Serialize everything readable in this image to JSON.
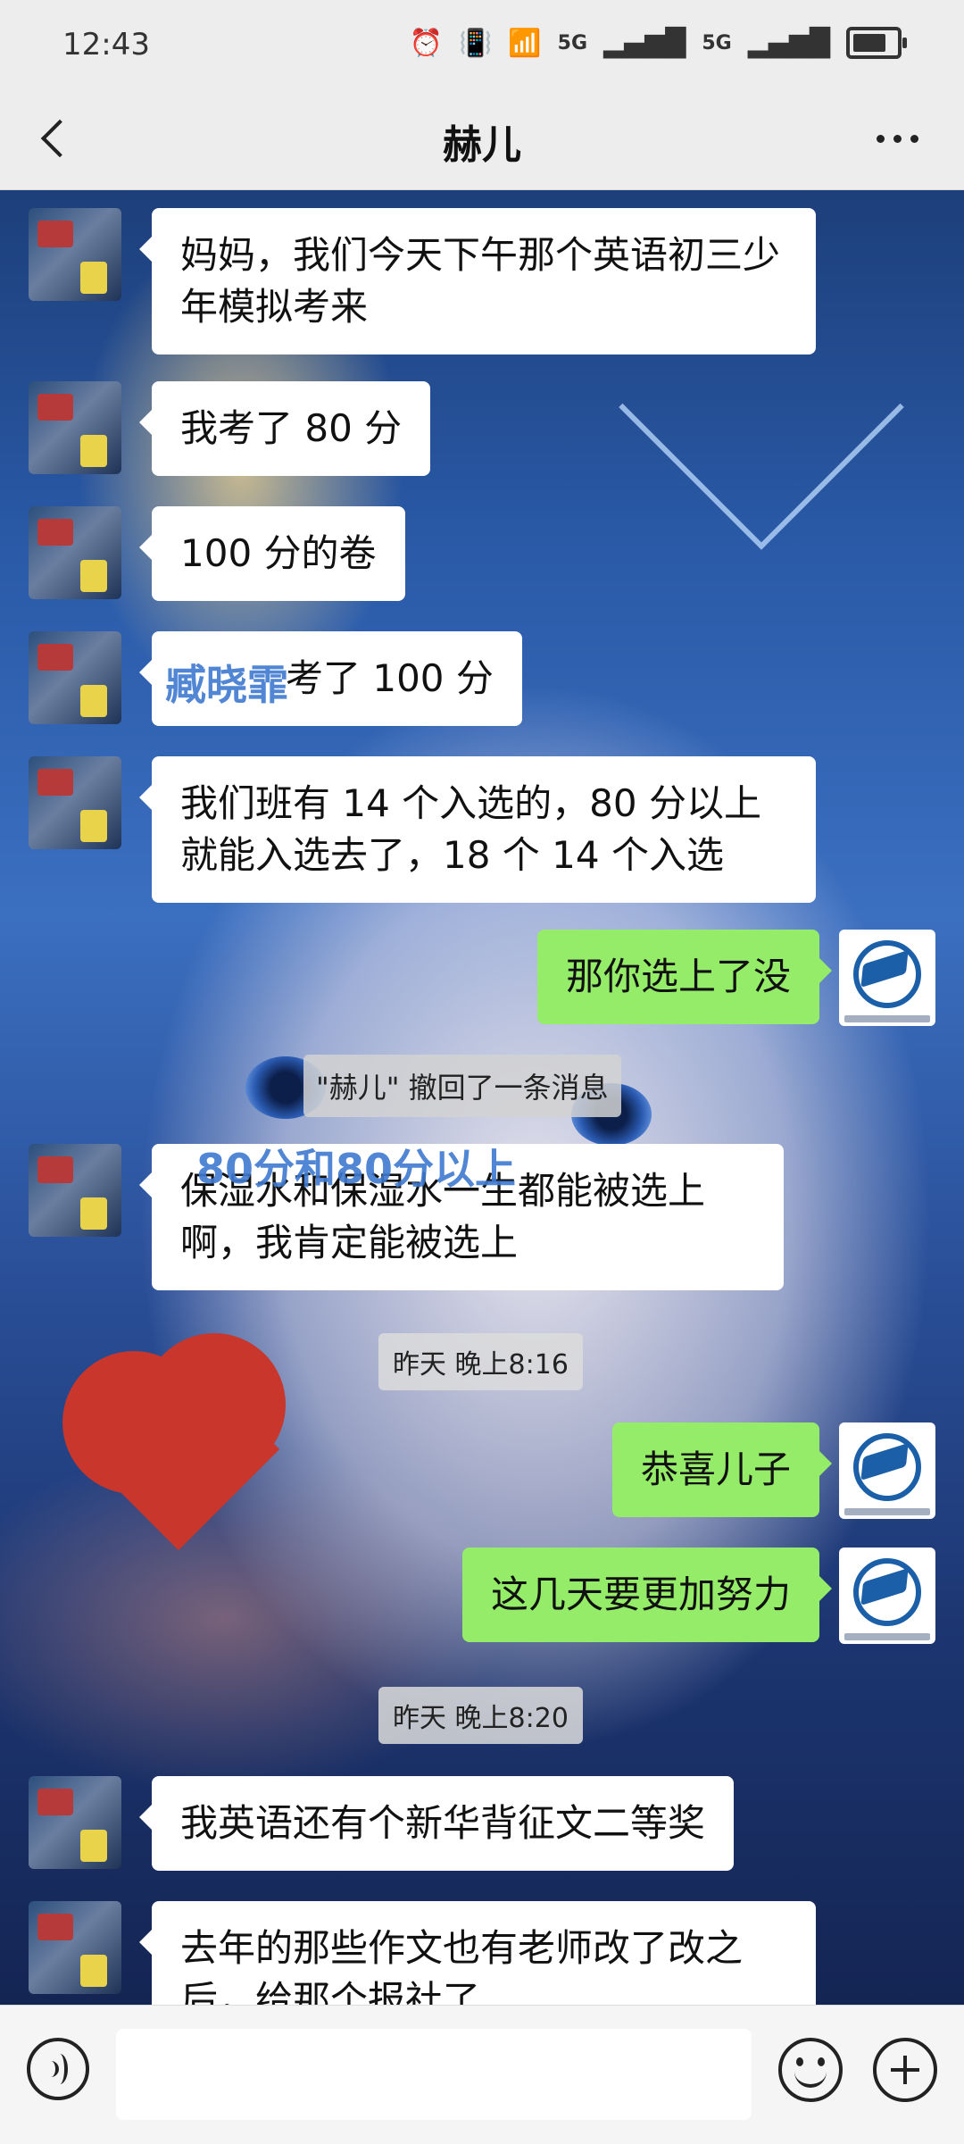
{
  "status_bar": {
    "time": "12:43",
    "icons": [
      "alarm-icon",
      "vibrate-icon",
      "wifi-icon",
      "signal-5g-icon",
      "signal-5g-icon",
      "battery-icon"
    ],
    "net1": "5G",
    "net2": "5G"
  },
  "header": {
    "title": "赫儿"
  },
  "messages": [
    {
      "side": "left",
      "text": "妈妈，我们今天下午那个英语初三少年模拟考来"
    },
    {
      "side": "left",
      "text": "我考了 80 分"
    },
    {
      "side": "left",
      "text": "100 分的卷"
    },
    {
      "side": "left",
      "text": "考了 100 分",
      "overlay": "臧晓霏"
    },
    {
      "side": "left",
      "text": "我们班有 14 个入选的，80 分以上就能入选去了，18 个 14 个入选"
    },
    {
      "side": "right",
      "text": "那你选上了没"
    },
    {
      "side": "left",
      "text": "保湿水和保湿水一生都能被选上啊，我肯定能被选上",
      "overlay": "80分和80分以上"
    },
    {
      "side": "right",
      "text": "恭喜儿子"
    },
    {
      "side": "right",
      "text": "这几天要更加努力"
    },
    {
      "side": "left",
      "text": "我英语还有个新华背征文二等奖"
    },
    {
      "side": "left",
      "text": "去年的那些作文也有老师改了改之后，给那个报社了"
    }
  ],
  "system_notes": {
    "recall": "\"赫儿\" 撤回了一条消息",
    "time1": "昨天 晚上8:16",
    "time2": "昨天 晚上8:20"
  },
  "input": {
    "placeholder": ""
  },
  "colors": {
    "left_bubble": "#ffffff",
    "right_bubble": "#95ec69",
    "header_bg": "#ededed"
  }
}
